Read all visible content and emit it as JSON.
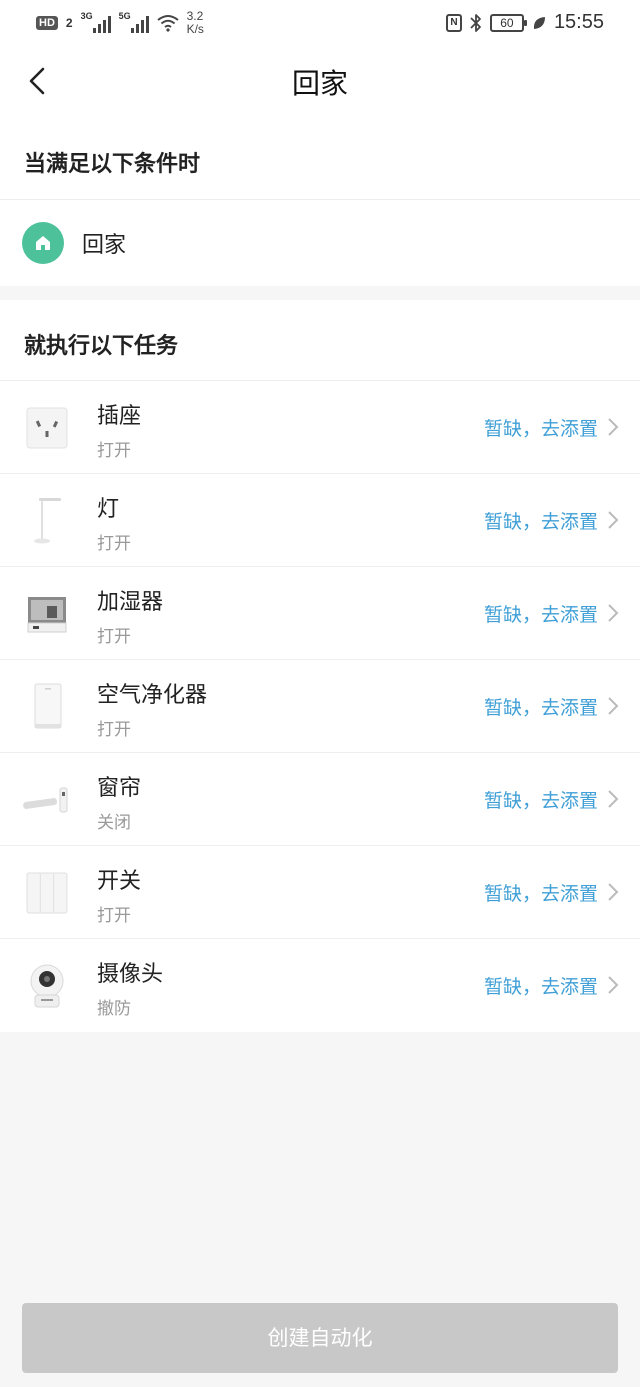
{
  "status_bar": {
    "hd_label": "HD",
    "hd_num": "2",
    "net1": "3G",
    "net2": "5G",
    "speed_value": "3.2",
    "speed_unit": "K/s",
    "nfc": "N",
    "battery": "60",
    "time": "15:55"
  },
  "header": {
    "title": "回家"
  },
  "condition": {
    "heading": "当满足以下条件时",
    "item_label": "回家"
  },
  "tasks": {
    "heading": "就执行以下任务",
    "items": [
      {
        "name": "插座",
        "state": "打开",
        "action": "暂缺，去添置",
        "icon": "socket-icon"
      },
      {
        "name": "灯",
        "state": "打开",
        "action": "暂缺，去添置",
        "icon": "lamp-icon"
      },
      {
        "name": "加湿器",
        "state": "打开",
        "action": "暂缺，去添置",
        "icon": "humidifier-icon"
      },
      {
        "name": "空气净化器",
        "state": "打开",
        "action": "暂缺，去添置",
        "icon": "air-purifier-icon"
      },
      {
        "name": "窗帘",
        "state": "关闭",
        "action": "暂缺，去添置",
        "icon": "curtain-motor-icon"
      },
      {
        "name": "开关",
        "state": "打开",
        "action": "暂缺，去添置",
        "icon": "wall-switch-icon"
      },
      {
        "name": "摄像头",
        "state": "撤防",
        "action": "暂缺，去添置",
        "icon": "camera-icon"
      }
    ]
  },
  "footer": {
    "create_label": "创建自动化"
  },
  "colors": {
    "accent_link": "#3f9fd6",
    "home_icon_bg": "#4cc19a",
    "button_disabled": "#c8c8c8"
  }
}
